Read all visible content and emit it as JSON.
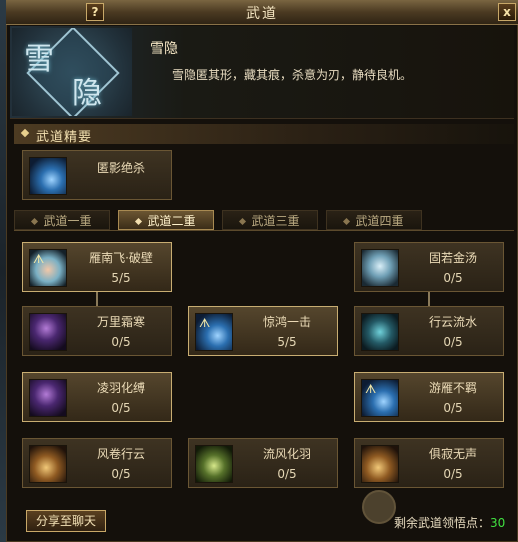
{
  "window": {
    "title": "武道",
    "help_label": "?",
    "close_label": "x"
  },
  "header": {
    "emblem_chars": [
      "雪",
      "隐"
    ],
    "skill_name": "雪隐",
    "skill_desc": "雪隐匿其形，藏其痕，杀意为刃，静待良机。"
  },
  "essentials": {
    "heading": "武道精要",
    "card": {
      "name": "匿影绝杀",
      "icon": "shadow-strike-icon"
    }
  },
  "tabs": [
    {
      "label": "武道一重",
      "active": false
    },
    {
      "label": "武道二重",
      "active": true
    },
    {
      "label": "武道三重",
      "active": false
    },
    {
      "label": "武道四重",
      "active": false
    }
  ],
  "skills": [
    {
      "name": "雁南飞·破壁",
      "value": "5/5",
      "glyph": "ᗑ",
      "icon": "goose-flight-icon",
      "active": true
    },
    {
      "name": "固若金汤",
      "value": "0/5",
      "glyph": "",
      "icon": "iron-wall-icon",
      "active": false
    },
    {
      "name": "万里霜寒",
      "value": "0/5",
      "glyph": "",
      "icon": "frost-icon",
      "active": false
    },
    {
      "name": "惊鸿一击",
      "value": "5/5",
      "glyph": "ᗑ",
      "icon": "swan-strike-icon",
      "active": true
    },
    {
      "name": "行云流水",
      "value": "0/5",
      "glyph": "",
      "icon": "flowing-cloud-icon",
      "active": false
    },
    {
      "name": "凌羽化缚",
      "value": "0/5",
      "glyph": "",
      "icon": "feather-bind-icon",
      "active": true
    },
    {
      "name": "游雁不羁",
      "value": "0/5",
      "glyph": "ᗑ",
      "icon": "wandering-goose-icon",
      "active": true
    },
    {
      "name": "风卷行云",
      "value": "0/5",
      "glyph": "",
      "icon": "wind-cloud-icon",
      "active": false
    },
    {
      "name": "流风化羽",
      "value": "0/5",
      "glyph": "",
      "icon": "wind-feather-icon",
      "active": false
    },
    {
      "name": "俱寂无声",
      "value": "0/5",
      "glyph": "",
      "icon": "silence-icon",
      "active": false
    }
  ],
  "footer": {
    "share_label": "分享至聊天",
    "points_label": "剩余武道领悟点：",
    "points_value": "30"
  },
  "colors": {
    "accent_gold": "#c8a868",
    "points_green": "#40e040"
  }
}
